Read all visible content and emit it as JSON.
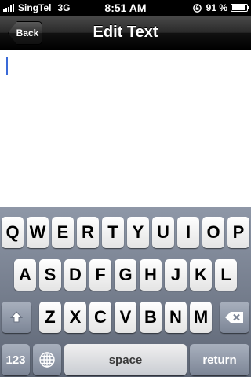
{
  "status_bar": {
    "carrier": "SingTel",
    "network": "3G",
    "time": "8:51 AM",
    "battery_percent": "91 %",
    "battery_level": 0.91,
    "signal_bars": 5,
    "icons": [
      "signal-icon",
      "rotation-lock-icon",
      "battery-icon"
    ]
  },
  "nav_bar": {
    "back_label": "Back",
    "title": "Edit Text"
  },
  "editor": {
    "text": "",
    "caret_color": "#3a6ad8"
  },
  "keyboard": {
    "row1": [
      "Q",
      "W",
      "E",
      "R",
      "T",
      "Y",
      "U",
      "I",
      "O",
      "P"
    ],
    "row2": [
      "A",
      "S",
      "D",
      "F",
      "G",
      "H",
      "J",
      "K",
      "L"
    ],
    "row3": [
      "Z",
      "X",
      "C",
      "V",
      "B",
      "N",
      "M"
    ],
    "numbers_label": "123",
    "space_label": "space",
    "return_label": "return",
    "icons": [
      "shift-icon",
      "delete-icon",
      "globe-icon"
    ]
  }
}
